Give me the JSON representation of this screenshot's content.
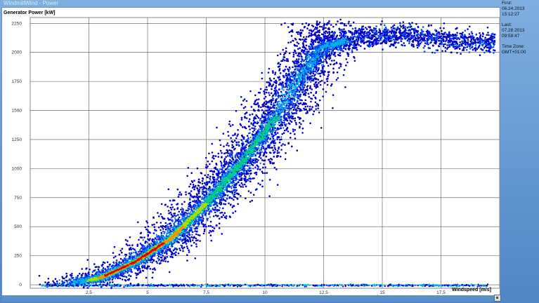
{
  "window": {
    "title": "WindmillWind - Power"
  },
  "side_panel": {
    "first_label": "First:",
    "first_date": "06.24.2013",
    "first_time": "15:12:27",
    "last_label": "Last:",
    "last_date": "07.28.2013",
    "last_time": "09:58:47",
    "tz_label": "Time Zone:",
    "tz_value": "GMT+01:00"
  },
  "chart_data": {
    "type": "scatter",
    "title": "",
    "ylabel": "Generator Power [kW]",
    "xlabel": "Windspeed [m/s]",
    "xlim": [
      0,
      20
    ],
    "ylim": [
      -30,
      2300
    ],
    "x_ticks": [
      2.5,
      5,
      7.5,
      10,
      12.5,
      15,
      17.5
    ],
    "x_tick_labels": [
      "2,5",
      "5",
      "7,5",
      "10",
      "12,5",
      "15",
      "17,5"
    ],
    "y_ticks": [
      0,
      250,
      500,
      750,
      1000,
      1250,
      1500,
      1750,
      2000,
      2250
    ],
    "y_tick_labels": [
      "0",
      "250",
      "500",
      "750",
      "1000",
      "1250",
      "1500",
      "1750",
      "2000",
      "2250"
    ],
    "grid": true,
    "density_colors": [
      "#0000c8",
      "#0050ff",
      "#00b4e6",
      "#00d278",
      "#b4dc00",
      "#ff8c00",
      "#dc0000"
    ],
    "power_curve": [
      {
        "x": 1.5,
        "y": 0
      },
      {
        "x": 3,
        "y": 60
      },
      {
        "x": 4.5,
        "y": 200
      },
      {
        "x": 6,
        "y": 400
      },
      {
        "x": 7.5,
        "y": 700
      },
      {
        "x": 9,
        "y": 1050
      },
      {
        "x": 10.5,
        "y": 1450
      },
      {
        "x": 11.5,
        "y": 1800
      },
      {
        "x": 12.5,
        "y": 2050
      },
      {
        "x": 14,
        "y": 2130
      },
      {
        "x": 16,
        "y": 2150
      },
      {
        "x": 19.5,
        "y": 2080
      }
    ]
  }
}
